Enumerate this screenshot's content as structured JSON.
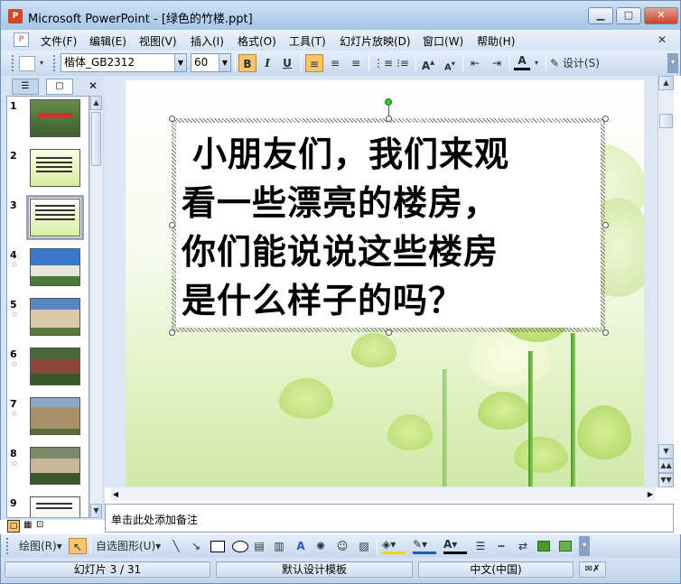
{
  "window": {
    "title": "Microsoft PowerPoint - [绿色的竹楼.ppt]",
    "app_icon": "P"
  },
  "window_controls": {
    "minimize": "▁",
    "maximize": "□",
    "close": "✕"
  },
  "menu": {
    "items": [
      "文件(F)",
      "编辑(E)",
      "视图(V)",
      "插入(I)",
      "格式(O)",
      "工具(T)",
      "幻灯片放映(D)",
      "窗口(W)",
      "帮助(H)"
    ],
    "close": "✕"
  },
  "formatting": {
    "font_name": "楷体_GB2312",
    "font_size": "60",
    "bold": "B",
    "italic": "I",
    "underline": "U",
    "design_label": "设计(S)"
  },
  "outline_tabs": {
    "close": "✕"
  },
  "slides": [
    {
      "num": "1",
      "star": ""
    },
    {
      "num": "2",
      "star": ""
    },
    {
      "num": "3",
      "star": ""
    },
    {
      "num": "4",
      "star": "☆"
    },
    {
      "num": "5",
      "star": "☆"
    },
    {
      "num": "6",
      "star": "☆"
    },
    {
      "num": "7",
      "star": "☆"
    },
    {
      "num": "8",
      "star": "☆"
    },
    {
      "num": "9",
      "star": ""
    }
  ],
  "slide_text": [
    "小朋友们，我们来观",
    "看一些漂亮的楼房，",
    "你们能说说这些楼房",
    "是什么样子的吗？"
  ],
  "notes": {
    "placeholder": "单击此处添加备注"
  },
  "drawing": {
    "draw_label": "绘图(R)",
    "autoshapes_label": "自选图形(U)"
  },
  "status": {
    "slide": "幻灯片 3 / 31",
    "template": "默认设计模板",
    "language": "中文(中国)"
  },
  "colors": {
    "accent": "#f9c56b",
    "frame": "#6d8fb8"
  }
}
